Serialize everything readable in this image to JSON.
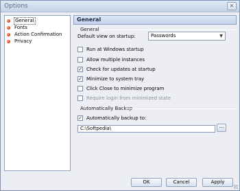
{
  "window": {
    "title": "Options",
    "close_glyph": "✕"
  },
  "sidebar": {
    "items": [
      {
        "label": "General",
        "selected": true
      },
      {
        "label": "Fonts"
      },
      {
        "label": "Action Confirmation"
      },
      {
        "label": "Privacy"
      }
    ]
  },
  "panel": {
    "header": "General",
    "general_group": "General",
    "default_view_label": "Default view on startup:",
    "default_view_value": "Passwords",
    "checkboxes": [
      {
        "label": "Run at Windows startup",
        "checked": false,
        "enabled": true
      },
      {
        "label": "Allow multiple instances",
        "checked": false,
        "enabled": true
      },
      {
        "label": "Check for updates at startup",
        "checked": true,
        "enabled": true
      },
      {
        "label": "Minimize to system tray",
        "checked": true,
        "enabled": true
      },
      {
        "label": "Click Close to minimize program",
        "checked": false,
        "enabled": true
      },
      {
        "label": "Require login from minimized state",
        "checked": false,
        "enabled": false
      }
    ],
    "backup_group": "Automatically Backup",
    "backup_checkbox": {
      "label": "Automatically backup to:",
      "checked": true
    },
    "backup_path": "C:\\Softpedia\\",
    "browse_label": "..."
  },
  "buttons": {
    "ok": "OK",
    "cancel": "Cancel",
    "apply": "Apply"
  },
  "check_glyph": "✓",
  "bullet_color": "#d8420e"
}
